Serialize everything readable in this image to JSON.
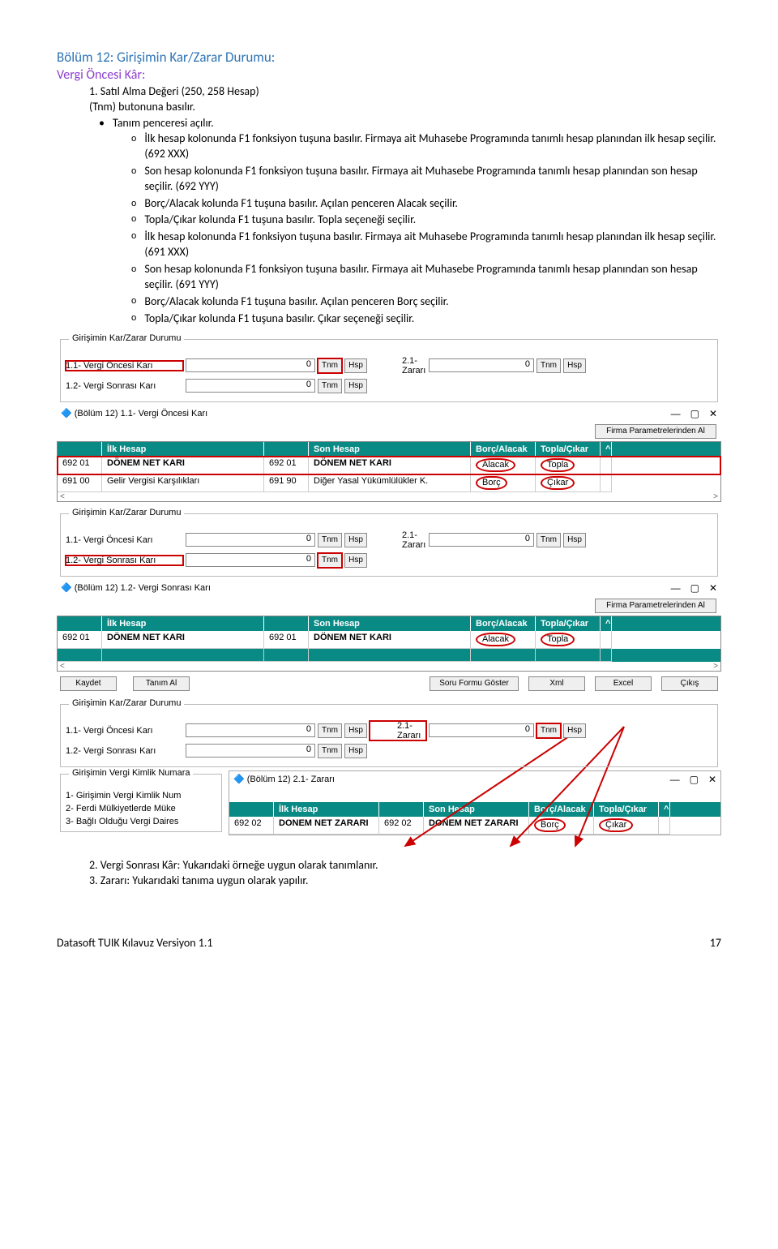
{
  "headings": {
    "section": "Bölüm 12: Girişimin Kar/Zarar Durumu:",
    "subsection": "Vergi Öncesi Kâr:",
    "item1": "1. Satıl Alma Değeri (250, 258 Hesap)",
    "line_tnm": "(Tnm) butonuna basılır.",
    "bullet_tanim": "Tanım penceresi açılır.",
    "p1": "İlk hesap kolonunda F1 fonksiyon tuşuna basılır. Firmaya ait Muhasebe Programında tanımlı hesap planından ilk hesap seçilir. (692 XXX)",
    "p2": "Son hesap kolonunda F1 fonksiyon tuşuna basılır. Firmaya ait Muhasebe Programında tanımlı hesap planından son hesap seçilir. (692 YYY)",
    "p3": "Borç/Alacak kolunda F1 tuşuna basılır. Açılan penceren Alacak seçilir.",
    "p4": "Topla/Çıkar kolunda F1 tuşuna basılır. Topla seçeneği seçilir.",
    "p5": "İlk hesap kolonunda F1 fonksiyon tuşuna basılır. Firmaya ait Muhasebe Programında tanımlı hesap planından ilk hesap seçilir. (691 XXX)",
    "p6": "Son hesap kolonunda F1 fonksiyon tuşuna basılır. Firmaya ait Muhasebe Programında tanımlı hesap planından son hesap seçilir. (691 YYY)",
    "p7": "Borç/Alacak kolunda F1 tuşuna basılır. Açılan penceren Borç seçilir.",
    "p8": "Topla/Çıkar kolunda F1 tuşuna basılır. Çıkar seçeneği seçilir."
  },
  "shot1": {
    "group": "Girişimin Kar/Zarar Durumu",
    "r1_label": "1.1- Vergi Öncesi Karı",
    "r2_label": "1.2- Vergi Sonrası Karı",
    "r1_val": "0",
    "r2_val": "0",
    "r21_label": "2.1- Zararı",
    "r21_val": "0",
    "btn_tnm": "Tnm",
    "btn_hsp": "Hsp",
    "win_title": "(Bölüm 12) 1.1- Vergi Öncesi Karı",
    "btn_param": "Firma Parametrelerinden Al",
    "h1": "İlk Hesap",
    "h2": "Son Hesap",
    "h3": "Borç/Alacak",
    "h4": "Topla/Çıkar",
    "row1_c1": "692 01",
    "row1_c2": "DÖNEM NET KARI",
    "row1_c3": "692 01",
    "row1_c4": "DÖNEM NET KARI",
    "row1_c5": "Alacak",
    "row1_c6": "Topla",
    "row2_c1": "691 00",
    "row2_c2": "Gelir Vergisi Karşılıkları",
    "row2_c3": "691 90",
    "row2_c4": "Diğer Yasal Yükümlülükler K.",
    "row2_c5": "Borç",
    "row2_c6": "Çıkar"
  },
  "shot2": {
    "group": "Girişimin Kar/Zarar Durumu",
    "r1_label": "1.1- Vergi Öncesi Karı",
    "r1_val": "0",
    "r2_label": "1.2- Vergi Sonrası Karı",
    "r2_val": "0",
    "r21_label": "2.1- Zararı",
    "r21_val": "0",
    "btn_tnm": "Tnm",
    "btn_hsp": "Hsp",
    "win_title": "(Bölüm 12) 1.2- Vergi Sonrası Karı",
    "btn_param": "Firma Parametrelerinden Al",
    "h1": "İlk Hesap",
    "h2": "Son Hesap",
    "h3": "Borç/Alacak",
    "h4": "Topla/Çıkar",
    "row1_c1": "692 01",
    "row1_c2": "DÖNEM NET KARI",
    "row1_c3": "692 01",
    "row1_c4": "DÖNEM NET KARI",
    "row1_c5": "Alacak",
    "row1_c6": "Topla",
    "btn_kaydet": "Kaydet",
    "btn_tanimal": "Tanım Al",
    "btn_sorgu": "Soru Formu Göster",
    "btn_xml": "Xml",
    "btn_excel": "Excel",
    "btn_cikis": "Çıkış"
  },
  "shot3": {
    "group": "Girişimin Kar/Zarar Durumu",
    "r1_label": "1.1- Vergi Öncesi Karı",
    "r1_val": "0",
    "r2_label": "1.2- Vergi Sonrası Karı",
    "r2_val": "0",
    "r21_label": "2.1- Zararı",
    "r21_val": "0",
    "btn_tnm": "Tnm",
    "btn_hsp": "Hsp",
    "group2": "Girişimin Vergi Kimlik Numara",
    "g2_l1": "1- Girişimin Vergi Kimlik Num",
    "g2_l2": "2- Ferdi Mülkiyetlerde Müke",
    "g2_l3": "3- Bağlı Olduğu Vergi Daires",
    "win_title": "(Bölüm 12) 2.1- Zararı",
    "h1": "İlk Hesap",
    "h2": "Son Hesap",
    "h3": "Borç/Alacak",
    "h4": "Topla/Çıkar",
    "row1_c1": "692 02",
    "row1_c2": "DONEM NET ZARARI",
    "row1_c3": "692 02",
    "row1_c4": "DONEM NET ZARARI",
    "row1_c5": "Borç",
    "row1_c6": "Çıkar"
  },
  "footer": {
    "item2": "2.   Vergi Sonrası Kâr: Yukarıdaki örneğe uygun olarak tanımlanır.",
    "item3": "3.   Zararı: Yukarıdaki tanıma uygun olarak yapılır.",
    "doc": "Datasoft TUIK Kılavuz Versiyon 1.1",
    "page": "17"
  }
}
